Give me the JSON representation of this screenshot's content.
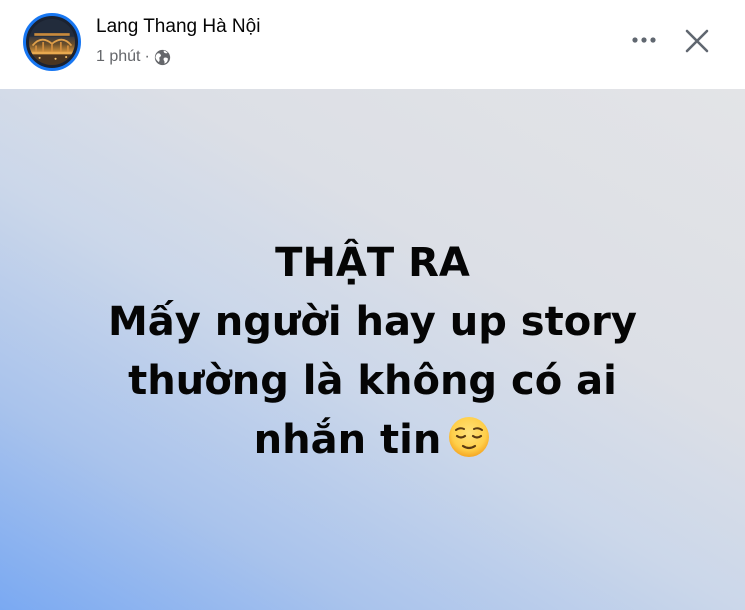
{
  "post": {
    "page_name": "Lang Thang Hà Nội",
    "time": "1 phút",
    "separator": "·",
    "privacy_icon": "globe-icon",
    "more_icon": "more-horizontal-icon",
    "close_icon": "close-icon",
    "content_lines": [
      "THẬT RA",
      "Mấy người hay up story",
      "thường là không có ai",
      "nhắn tin"
    ],
    "emoji": "relieved-face-icon"
  },
  "colors": {
    "avatar_ring": "#1877f2",
    "name_text": "#050505",
    "meta_text": "#65676b",
    "post_bg_left": "#7aa9f2",
    "post_bg_right": "#e3e4e7",
    "post_text": "#050505"
  }
}
